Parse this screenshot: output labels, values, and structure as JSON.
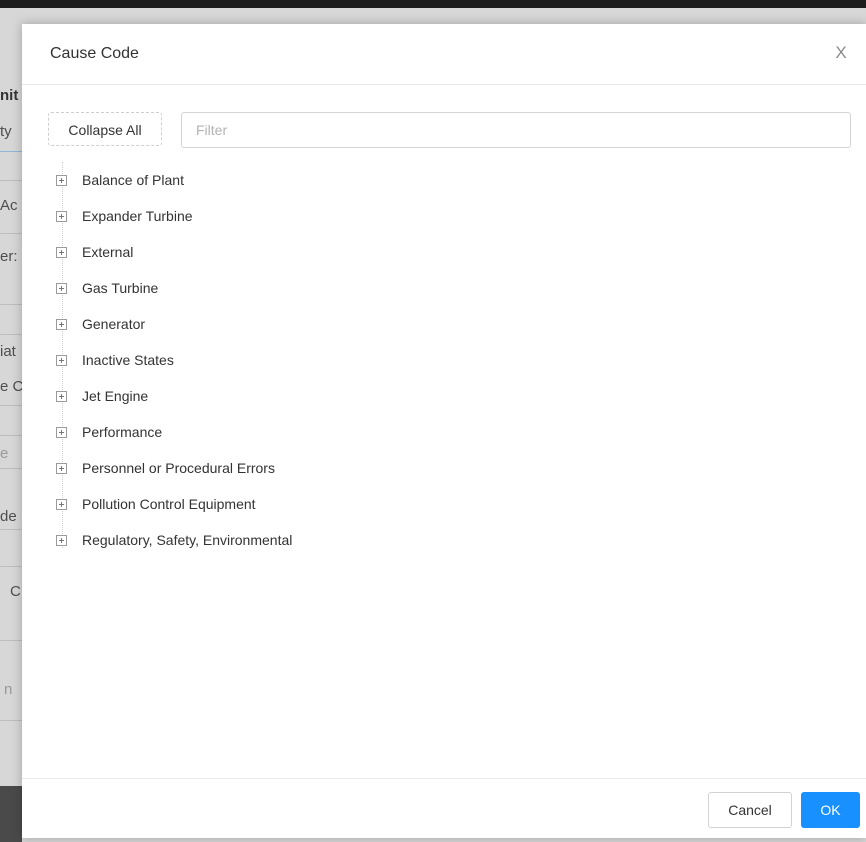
{
  "modal": {
    "title": "Cause Code",
    "close_glyph": "X"
  },
  "toolbar": {
    "collapse_all_label": "Collapse All",
    "filter_placeholder": "Filter",
    "filter_value": ""
  },
  "tree": {
    "expand_icon": "plus-square-icon",
    "items": [
      {
        "label": "Balance of Plant"
      },
      {
        "label": "Expander Turbine"
      },
      {
        "label": "External"
      },
      {
        "label": "Gas Turbine"
      },
      {
        "label": "Generator"
      },
      {
        "label": "Inactive States"
      },
      {
        "label": "Jet Engine"
      },
      {
        "label": "Performance"
      },
      {
        "label": "Personnel or Procedural Errors"
      },
      {
        "label": "Pollution Control Equipment"
      },
      {
        "label": "Regulatory, Safety, Environmental"
      }
    ]
  },
  "footer": {
    "cancel_label": "Cancel",
    "ok_label": "OK"
  },
  "background": {
    "fragments": [
      "nit",
      "ty",
      "Ac",
      "er:",
      "iat",
      "e C",
      "e",
      "de",
      "C",
      "n"
    ]
  },
  "colors": {
    "primary": "#1890ff",
    "overlay": "#d7d7d7"
  }
}
